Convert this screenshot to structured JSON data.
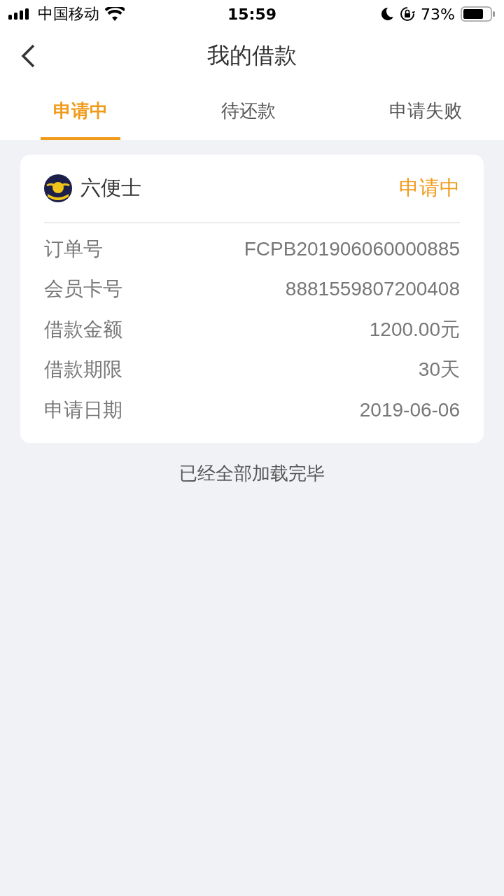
{
  "status_bar": {
    "carrier": "中国移动",
    "time": "15:59",
    "battery": "73%"
  },
  "nav": {
    "title": "我的借款"
  },
  "tabs": [
    {
      "label": "申请中",
      "selected": true
    },
    {
      "label": "待还款",
      "selected": false
    },
    {
      "label": "申请失败",
      "selected": false
    }
  ],
  "loans": [
    {
      "lender": "六便士",
      "status": "申请中",
      "fields": [
        {
          "label": "订单号",
          "value": "FCPB201906060000885"
        },
        {
          "label": "会员卡号",
          "value": "8881559807200408"
        },
        {
          "label": "借款金额",
          "value": "1200.00元"
        },
        {
          "label": "借款期限",
          "value": "30天"
        },
        {
          "label": "申请日期",
          "value": "2019-06-06"
        }
      ]
    }
  ],
  "footer": "已经全部加载完毕"
}
